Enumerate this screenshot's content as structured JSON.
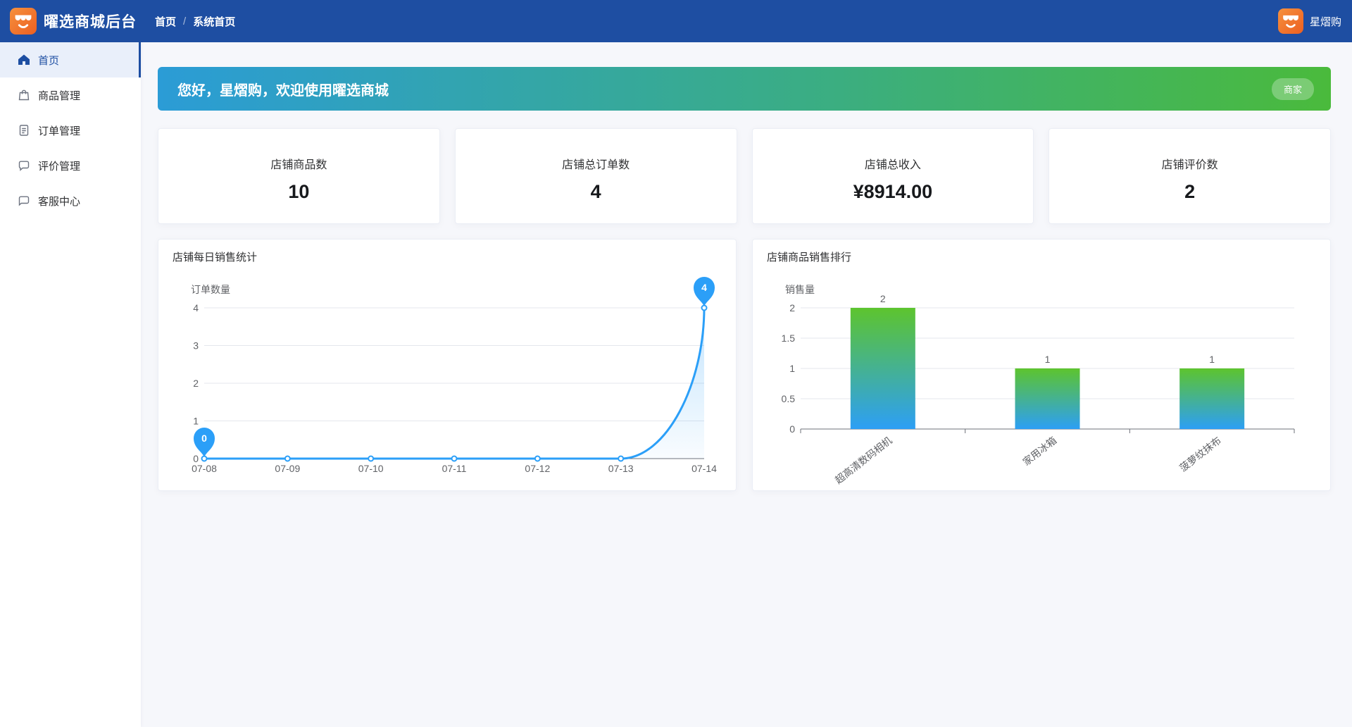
{
  "navbar": {
    "brand": "曜选商城后台",
    "breadcrumb": [
      "首页",
      "系统首页"
    ],
    "breadcrumb_sep": "/",
    "user": "星熠购"
  },
  "sidebar": {
    "items": [
      {
        "label": "首页",
        "icon": "home-icon",
        "active": true
      },
      {
        "label": "商品管理",
        "icon": "shopping-bag-icon",
        "active": false
      },
      {
        "label": "订单管理",
        "icon": "order-document-icon",
        "active": false
      },
      {
        "label": "评价管理",
        "icon": "review-comment-icon",
        "active": false
      },
      {
        "label": "客服中心",
        "icon": "service-chat-icon",
        "active": false
      }
    ]
  },
  "banner": {
    "greeting": "您好，星熠购，欢迎使用曜选商城",
    "badge": "商家"
  },
  "stats": [
    {
      "label": "店铺商品数",
      "value": "10"
    },
    {
      "label": "店铺总订单数",
      "value": "4"
    },
    {
      "label": "店铺总收入",
      "value": "¥8914.00"
    },
    {
      "label": "店铺评价数",
      "value": "2"
    }
  ],
  "chart_data": [
    {
      "type": "line",
      "title": "店铺每日销售统计",
      "ylabel": "订单数量",
      "x": [
        "07-08",
        "07-09",
        "07-10",
        "07-11",
        "07-12",
        "07-13",
        "07-14"
      ],
      "values": [
        0,
        0,
        0,
        0,
        0,
        0,
        4
      ],
      "ylim": [
        0,
        4
      ],
      "yticks": [
        0,
        1,
        2,
        3,
        4
      ],
      "grid": true,
      "smooth": true,
      "color": "#2b9ff8",
      "area_color": "#2b9ff8",
      "markers": [
        {
          "x": "07-08",
          "value": 0
        },
        {
          "x": "07-14",
          "value": 4
        }
      ]
    },
    {
      "type": "bar",
      "title": "店铺商品销售排行",
      "ylabel": "销售量",
      "categories": [
        "超高清数码相机",
        "家用冰箱",
        "菠萝纹抹布"
      ],
      "values": [
        2,
        1,
        1
      ],
      "value_labels": [
        "2",
        "1",
        "1"
      ],
      "ylim": [
        0,
        2
      ],
      "yticks": [
        0,
        0.5,
        1,
        1.5,
        2
      ],
      "grid": true,
      "label_rotate": -38,
      "gradient": [
        "#5dc42e",
        "#2d9ff5"
      ]
    }
  ],
  "colors": {
    "navbar_bg": "#1e4ea2",
    "banner_from": "#2b9cd6",
    "banner_to": "#4aba3c",
    "line_series": "#2b9ff8",
    "bar_top": "#5dc42e",
    "bar_bottom": "#2d9ff5"
  }
}
